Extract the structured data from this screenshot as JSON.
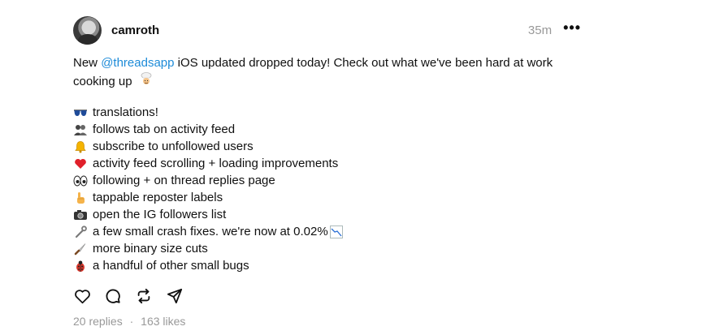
{
  "post": {
    "author": {
      "username": "camroth",
      "avatar_icon": "avatar-photo"
    },
    "timestamp": "35m",
    "more_label": "•••",
    "text": {
      "before_mention": "New ",
      "mention": "@threadsapp",
      "after_mention": " iOS updated dropped today! Check out what we've been hard at work cooking up"
    },
    "items": [
      {
        "icon": "sunglasses-emoji",
        "glyph": "🕶",
        "label": "translations!"
      },
      {
        "icon": "people-emoji",
        "glyph": "👥",
        "label": "follows tab on activity feed"
      },
      {
        "icon": "bell-emoji",
        "glyph": "🔔",
        "label": "subscribe to unfollowed users"
      },
      {
        "icon": "heart-emoji",
        "glyph": "❤",
        "label": "activity feed scrolling + loading improvements"
      },
      {
        "icon": "eyes-emoji",
        "glyph": "👀",
        "label": "following + on thread replies page"
      },
      {
        "icon": "pointing-hand-emoji",
        "glyph": "👆",
        "label": "tappable reposter labels"
      },
      {
        "icon": "camera-emoji",
        "glyph": "📷",
        "label": "open the IG followers list"
      },
      {
        "icon": "wrench-emoji",
        "glyph": "🔧",
        "label": "a few small crash fixes. we're now at 0.02%"
      },
      {
        "icon": "knife-emoji",
        "glyph": "🔪",
        "label": "more binary size cuts"
      },
      {
        "icon": "bug-emoji",
        "glyph": "🐞",
        "label": "a handful of other small bugs"
      }
    ],
    "stats": {
      "replies": "20 replies",
      "separator": "·",
      "likes": "163 likes"
    }
  },
  "colors": {
    "mention": "#1d8bd8",
    "muted": "#999999",
    "text": "#101010"
  }
}
